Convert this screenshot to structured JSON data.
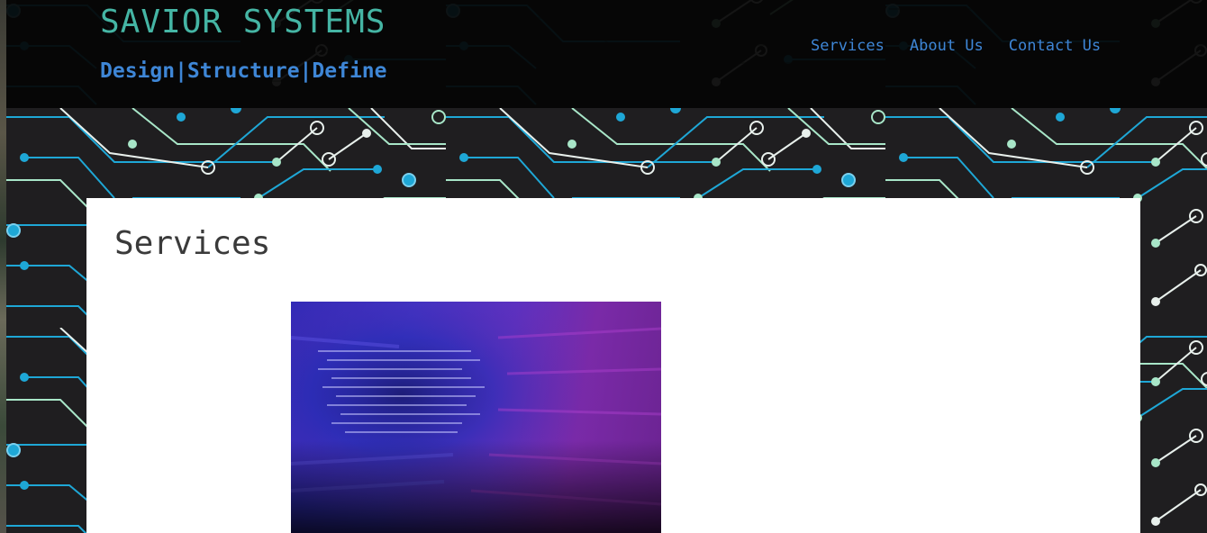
{
  "header": {
    "site_title": "SAVIOR SYSTEMS",
    "tagline": "Design|Structure|Define"
  },
  "nav": {
    "items": [
      {
        "label": "Services"
      },
      {
        "label": "About Us"
      },
      {
        "label": "Contact Us"
      }
    ]
  },
  "main": {
    "page_title": "Services"
  },
  "colors": {
    "site_title": "#45b5a4",
    "link": "#3e86d6",
    "circuit_blue": "#1ea7d6",
    "circuit_mint": "#a8e6c8",
    "circuit_white": "#e8f0ec",
    "background": "#1c1c1e"
  }
}
